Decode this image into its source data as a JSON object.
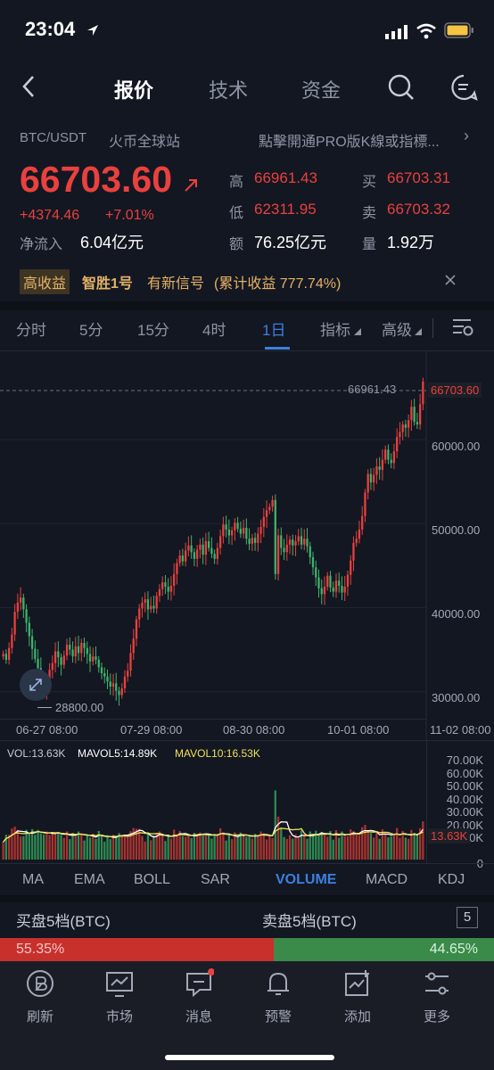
{
  "status": {
    "time": "23:04"
  },
  "nav": {
    "tabs": [
      "报价",
      "技术",
      "资金"
    ]
  },
  "pair": {
    "symbol": "BTC/USDT",
    "exchange": "火币全球站",
    "promo": "點擊開通PRO版K線或指標..."
  },
  "price": {
    "last": "66703.60",
    "change": "+4374.46",
    "change_pct": "+7.01%",
    "net_inflow_label": "净流入",
    "net_inflow": "6.04亿元"
  },
  "stats": {
    "high_label": "高",
    "high": "66961.43",
    "low_label": "低",
    "low": "62311.95",
    "amount_label": "额",
    "amount": "76.25亿元",
    "buy_label": "买",
    "buy": "66703.31",
    "sell_label": "卖",
    "sell": "66703.32",
    "volume_label": "量",
    "volume": "1.92万"
  },
  "signal": {
    "badge": "高收益",
    "name": "智胜1号",
    "text": "有新信号",
    "yield": "(累计收益 777.74%)"
  },
  "periods": [
    "分时",
    "5分",
    "15分",
    "4时",
    "1日",
    "指标",
    "高级"
  ],
  "chart_data": {
    "type": "candlestick",
    "x_ticks": [
      "06-27 08:00",
      "07-29 08:00",
      "08-30 08:00",
      "10-01 08:00",
      "11-02 08:00"
    ],
    "y_ticks": [
      30000,
      40000,
      50000,
      60000
    ],
    "y_tick_labels": [
      "30000.00",
      "40000.00",
      "50000.00",
      "60000.00"
    ],
    "ylim": [
      27000,
      70500
    ],
    "max_marker": "66961.43",
    "min_marker": "28800.00",
    "last_price_label": "66703.60",
    "close_series": [
      34500,
      33800,
      35200,
      36800,
      39500,
      40600,
      41200,
      39800,
      38200,
      36600,
      35100,
      33900,
      32800,
      31600,
      29900,
      31200,
      32600,
      33400,
      34800,
      34100,
      33200,
      34300,
      35600,
      35000,
      34200,
      35400,
      34600,
      35800,
      35200,
      34500,
      33600,
      34200,
      33800,
      32900,
      32200,
      31800,
      31200,
      30600,
      31000,
      30100,
      29600,
      30400,
      31800,
      32500,
      34600,
      36300,
      38600,
      39900,
      40600,
      41000,
      39800,
      40200,
      39900,
      41400,
      42200,
      43000,
      42500,
      41900,
      42600,
      44000,
      45300,
      46200,
      45500,
      46800,
      47400,
      46600,
      45800,
      46900,
      47500,
      46300,
      47900,
      47100,
      46400,
      45800,
      47100,
      48500,
      49900,
      49300,
      48600,
      49200,
      50100,
      49400,
      48800,
      49500,
      48200,
      47600,
      48300,
      47700,
      48800,
      49600,
      50800,
      51600,
      52000,
      52800,
      44000,
      48600,
      47100,
      46600,
      47500,
      48100,
      47400,
      47900,
      48500,
      47500,
      48200,
      47300,
      46000,
      44800,
      43600,
      42300,
      41600,
      42500,
      43800,
      42400,
      41900,
      43200,
      42600,
      41800,
      42500,
      43900,
      45600,
      47700,
      48200,
      49300,
      50900,
      53700,
      55900,
      54900,
      55800,
      56800,
      56400,
      57600,
      58800,
      57600,
      57200,
      58600,
      60300,
      60900,
      61800,
      61400,
      62300,
      63900,
      62100,
      61800,
      64200,
      66900
    ]
  },
  "volume": {
    "legend_vol": "VOL:13.63K",
    "legend_mavol5": "MAVOL5:14.89K",
    "legend_mavol10": "MAVOL10:16.53K",
    "last_label": "13.63K",
    "y_tick_labels": [
      "70.00K",
      "60.00K",
      "50.00K",
      "40.00K",
      "30.00K",
      "20.00K",
      "10.00K",
      "0"
    ]
  },
  "indicators": [
    "MA",
    "EMA",
    "BOLL",
    "SAR",
    "VOLUME",
    "MACD",
    "KDJ"
  ],
  "depth": {
    "buy_label": "买盘5档(BTC)",
    "sell_label": "卖盘5档(BTC)",
    "levels": "5",
    "buy_pct": "55.35%",
    "sell_pct": "44.65%",
    "buy_ratio": 0.5535
  },
  "bottom_nav": [
    "刷新",
    "市场",
    "消息",
    "预警",
    "添加",
    "更多"
  ],
  "colors": {
    "up": "#e8413e",
    "down": "#3eb36a",
    "accent": "#3d7fe0",
    "background": "#131722"
  }
}
